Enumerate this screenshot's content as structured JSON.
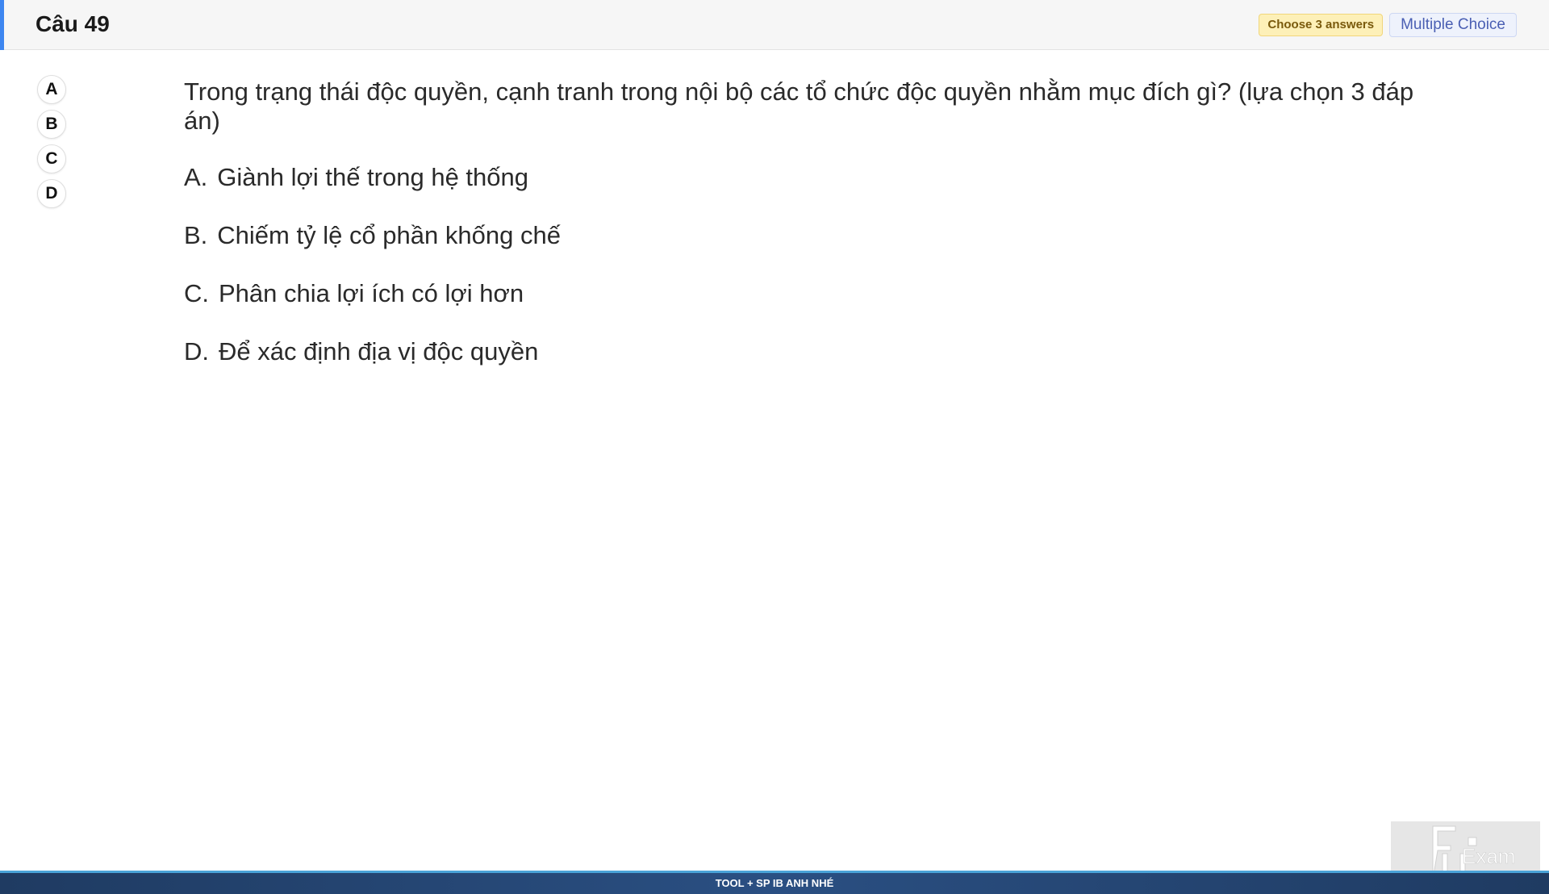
{
  "header": {
    "title": "Câu 49",
    "answer_count_badge": "Choose 3 answers",
    "question_type_badge": "Multiple Choice"
  },
  "answer_selector": [
    "A",
    "B",
    "C",
    "D"
  ],
  "question": {
    "text": "Trong trạng thái độc quyền, cạnh tranh trong nội bộ các tổ chức độc quyền nhằm mục đích gì? (lựa chọn 3 đáp án)",
    "options": [
      {
        "letter": "A.",
        "text": "Giành lợi thế trong hệ thống"
      },
      {
        "letter": "B.",
        "text": "Chiếm tỷ lệ cổ phần khống chế"
      },
      {
        "letter": "C.",
        "text": "Phân chia lợi ích có lợi hơn"
      },
      {
        "letter": "D.",
        "text": "Để xác định địa vị độc quyền"
      }
    ]
  },
  "footer": {
    "banner_text": "TOOL + SP IB ANH NHÉ"
  },
  "logo": {
    "text": "Exam",
    "icon": "fu-exam-logo-icon"
  },
  "colors": {
    "accent": "#3d86f0",
    "badge_count_bg": "#fdf0b8",
    "badge_type_bg": "#eef2fc",
    "footer_bg": "#1f3b62"
  }
}
